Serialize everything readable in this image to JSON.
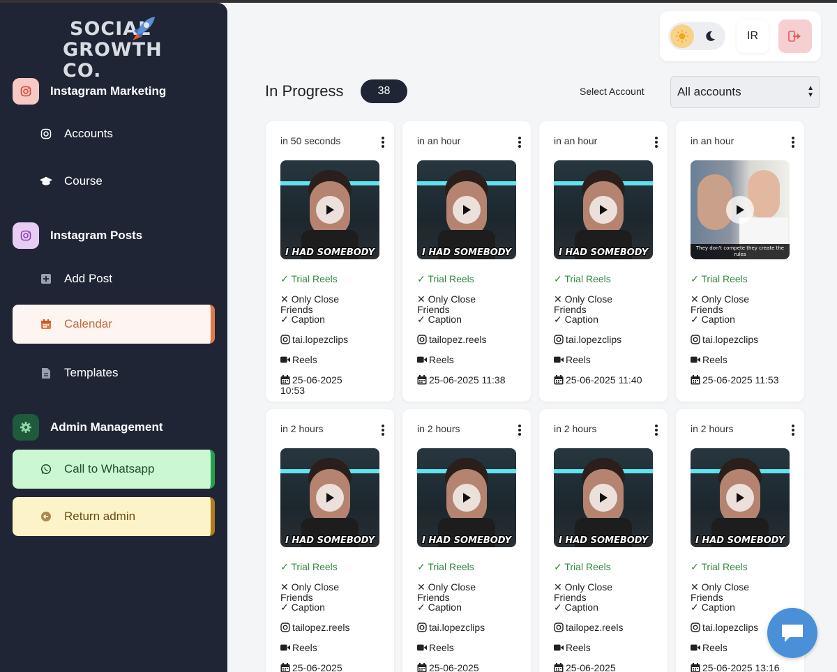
{
  "brand": {
    "line1": "SOCIAL",
    "line2": "GROWTH CO."
  },
  "sidebar": {
    "sections": [
      {
        "label": "Instagram Marketing",
        "icon": "instagram-icon",
        "color": "#f6c9c4"
      },
      {
        "label": "Instagram Posts",
        "icon": "instagram-icon",
        "color": "#e6cdf3"
      },
      {
        "label": "Admin Management",
        "icon": "gear-icon",
        "color": "#1e5a3b"
      }
    ],
    "items": [
      {
        "label": "Accounts",
        "icon": "instagram-icon"
      },
      {
        "label": "Course",
        "icon": "graduation-cap-icon"
      },
      {
        "label": "Add Post",
        "icon": "plus-square-icon"
      },
      {
        "label": "Calendar",
        "icon": "calendar-icon"
      },
      {
        "label": "Templates",
        "icon": "document-icon"
      },
      {
        "label": "Call to Whatsapp",
        "icon": "whatsapp-icon"
      },
      {
        "label": "Return admin",
        "icon": "arrow-left-icon"
      }
    ]
  },
  "top_controls": {
    "language": "IR"
  },
  "header": {
    "title": "In Progress",
    "count": "38",
    "select_label": "Select Account",
    "select_value": "All accounts"
  },
  "labels": {
    "trial": "Trial Reels",
    "close_friends": "Only Close Friends",
    "caption": "Caption",
    "type": "Reels"
  },
  "posts": [
    {
      "time": "in 50 seconds",
      "account": "tai.lopezclips",
      "date": "25-06-2025 10:53",
      "thumb_text": "I HAD SOMEBODY"
    },
    {
      "time": "in an hour",
      "account": "tailopez.reels",
      "date": "25-06-2025 11:38",
      "thumb_text": "I HAD SOMEBODY"
    },
    {
      "time": "in an hour",
      "account": "tai.lopezclips",
      "date": "25-06-2025 11:40",
      "thumb_text": "I HAD SOMEBODY"
    },
    {
      "time": "in an hour",
      "account": "tai.lopezclips",
      "date": "25-06-2025 11:53",
      "thumb_text": "They don't compete they create the rules"
    },
    {
      "time": "in 2 hours",
      "account": "tailopez.reels",
      "date": "25-06-2025",
      "thumb_text": "I HAD SOMEBODY"
    },
    {
      "time": "in 2 hours",
      "account": "tai.lopezclips",
      "date": "25-06-2025",
      "thumb_text": "I HAD SOMEBODY"
    },
    {
      "time": "in 2 hours",
      "account": "tailopez.reels",
      "date": "25-06-2025",
      "thumb_text": "I HAD SOMEBODY"
    },
    {
      "time": "in 2 hours",
      "account": "tai.lopezclips",
      "date": "25-06-2025 13:16",
      "thumb_text": "I HAD SOMEBODY"
    }
  ]
}
